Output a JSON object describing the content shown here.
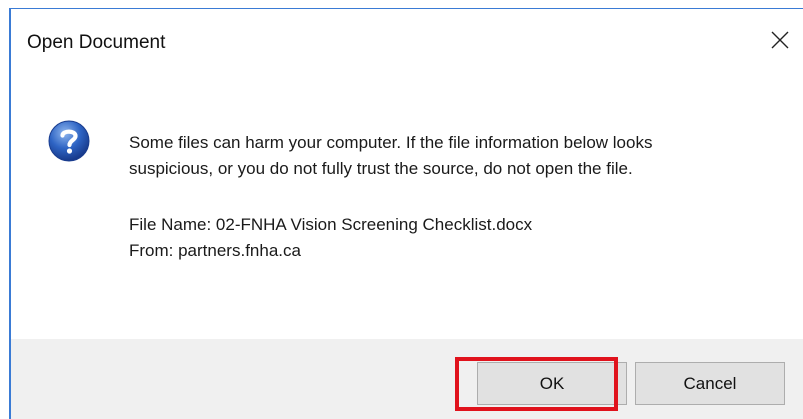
{
  "dialog": {
    "title": "Open Document",
    "message_line1": "Some files can harm your computer. If the file information below looks",
    "message_line2": "suspicious, or you do not fully trust the source, do not open the file.",
    "file_name_line": "File Name: 02-FNHA Vision Screening Checklist.docx",
    "from_line": "From: partners.fnha.ca",
    "icon": "question-icon",
    "close_icon": "close-icon"
  },
  "buttons": {
    "ok_label": "OK",
    "cancel_label": "Cancel"
  },
  "colors": {
    "accent_border": "#3a7bd5",
    "highlight": "#e0121c",
    "footer_bg": "#f0f0f0"
  }
}
